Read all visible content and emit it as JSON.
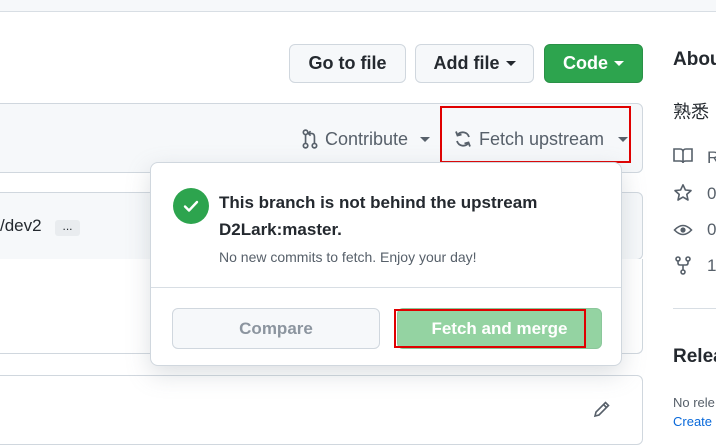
{
  "header": {
    "go_to_file": "Go to file",
    "add_file": "Add file",
    "code": "Code"
  },
  "branch_bar": {
    "contribute": "Contribute",
    "fetch_upstream": "Fetch upstream"
  },
  "commit_row": {
    "branch_fragment": "/dev2",
    "ellipsis": "..."
  },
  "popover": {
    "title": "This branch is not behind the upstream D2Lark:master.",
    "subtitle": "No new commits to fetch. Enjoy your day!",
    "compare": "Compare",
    "fetch_and_merge": "Fetch and merge"
  },
  "sidebar": {
    "about": "Abou",
    "description": "熟悉",
    "readme": "R",
    "stars": "0",
    "watchers": "0",
    "forks": "1",
    "releases_heading": "Relea",
    "no_releases": "No rele",
    "create_link": "Create"
  },
  "colors": {
    "primary_green": "#2da44e",
    "disabled_green": "#94d3a2",
    "highlight_red": "#e00000"
  }
}
